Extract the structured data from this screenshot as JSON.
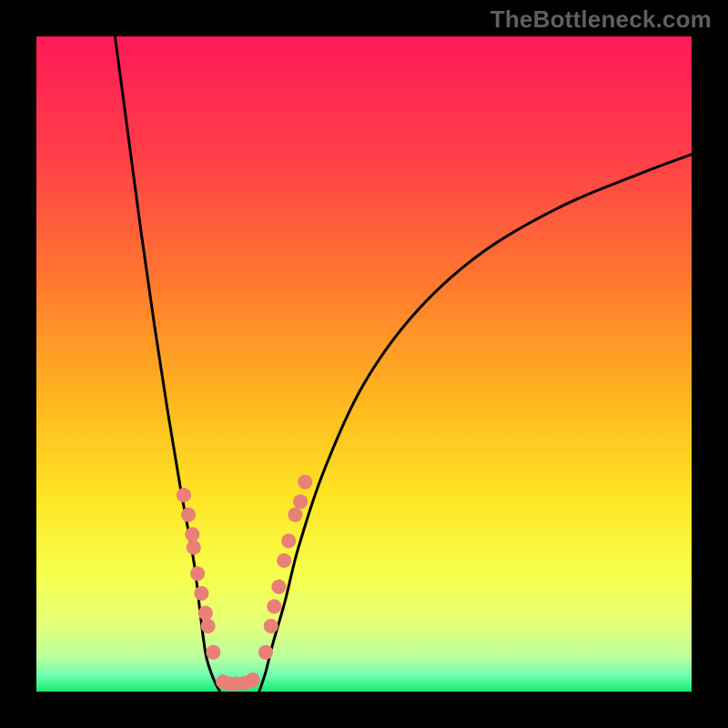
{
  "watermark": "TheBottleneck.com",
  "chart_data": {
    "type": "line",
    "title": "",
    "xlabel": "",
    "ylabel": "",
    "xlim": [
      0,
      100
    ],
    "ylim": [
      0,
      100
    ],
    "series": [
      {
        "name": "left-curve",
        "x": [
          12,
          14,
          16,
          18,
          20,
          22,
          24,
          25,
          25.5,
          26,
          27,
          28
        ],
        "y": [
          100,
          85,
          70,
          56,
          43,
          31,
          20,
          12,
          8,
          5,
          2,
          0
        ]
      },
      {
        "name": "right-curve",
        "x": [
          34,
          35,
          36,
          38,
          40,
          44,
          50,
          58,
          68,
          80,
          92,
          100
        ],
        "y": [
          0,
          3,
          7,
          14,
          22,
          34,
          47,
          58,
          67,
          74,
          79,
          82
        ]
      },
      {
        "name": "marker-cluster-left",
        "x": [
          22.5,
          23.2,
          23.8,
          24.0,
          24.6,
          25.2,
          25.8,
          26.2,
          27.0
        ],
        "y": [
          30,
          27,
          24,
          22,
          18,
          15,
          12,
          10,
          6
        ]
      },
      {
        "name": "marker-cluster-right",
        "x": [
          35.0,
          35.8,
          36.3,
          37.0,
          37.8,
          38.5,
          39.5,
          40.3,
          41.0
        ],
        "y": [
          6,
          10,
          13,
          16,
          20,
          23,
          27,
          29,
          32
        ]
      },
      {
        "name": "marker-bottom",
        "x": [
          28.5,
          29.5,
          30.5,
          31.8,
          33.0
        ],
        "y": [
          1.5,
          1.2,
          1.2,
          1.3,
          1.8
        ]
      }
    ],
    "background_gradient": {
      "stops": [
        {
          "offset": 0.0,
          "color": "#ff1a57"
        },
        {
          "offset": 0.18,
          "color": "#ff3e48"
        },
        {
          "offset": 0.38,
          "color": "#ff7a2e"
        },
        {
          "offset": 0.55,
          "color": "#ffb51f"
        },
        {
          "offset": 0.7,
          "color": "#ffe424"
        },
        {
          "offset": 0.82,
          "color": "#f6ff4b"
        },
        {
          "offset": 0.9,
          "color": "#e4ff7a"
        },
        {
          "offset": 0.95,
          "color": "#b7ffa1"
        },
        {
          "offset": 0.975,
          "color": "#6fffb0"
        },
        {
          "offset": 1.0,
          "color": "#17e86f"
        }
      ]
    },
    "marker_color": "#e98078",
    "curve_color": "#000000"
  }
}
